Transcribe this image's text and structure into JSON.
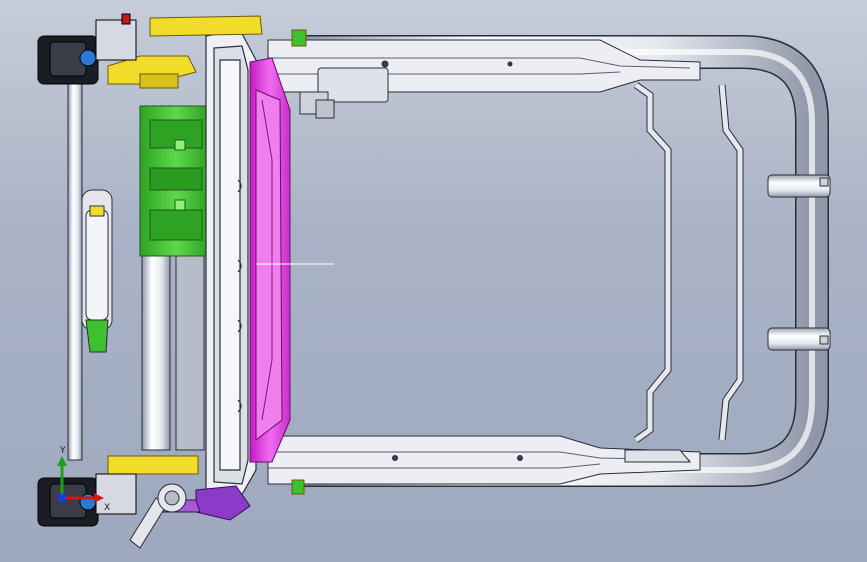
{
  "viewport": {
    "background_top": "#c6ccd8",
    "background_bottom": "#9ea9bf"
  },
  "triad": {
    "y_label": "Y",
    "x_label": "X",
    "y_color": "#1aa01a",
    "x_color": "#d01818",
    "z_color": "#1840d8"
  },
  "parts": {
    "frame_color": "#e6e8ee",
    "frame_edge": "#2a2d3a",
    "yellow_color": "#f2dc2a",
    "green_color": "#3ec12e",
    "magenta_color": "#e43ce0",
    "purple_color": "#8a3cc8",
    "black_color": "#1b1d24"
  },
  "icons": {
    "triad": "coordinate-triad-icon"
  }
}
